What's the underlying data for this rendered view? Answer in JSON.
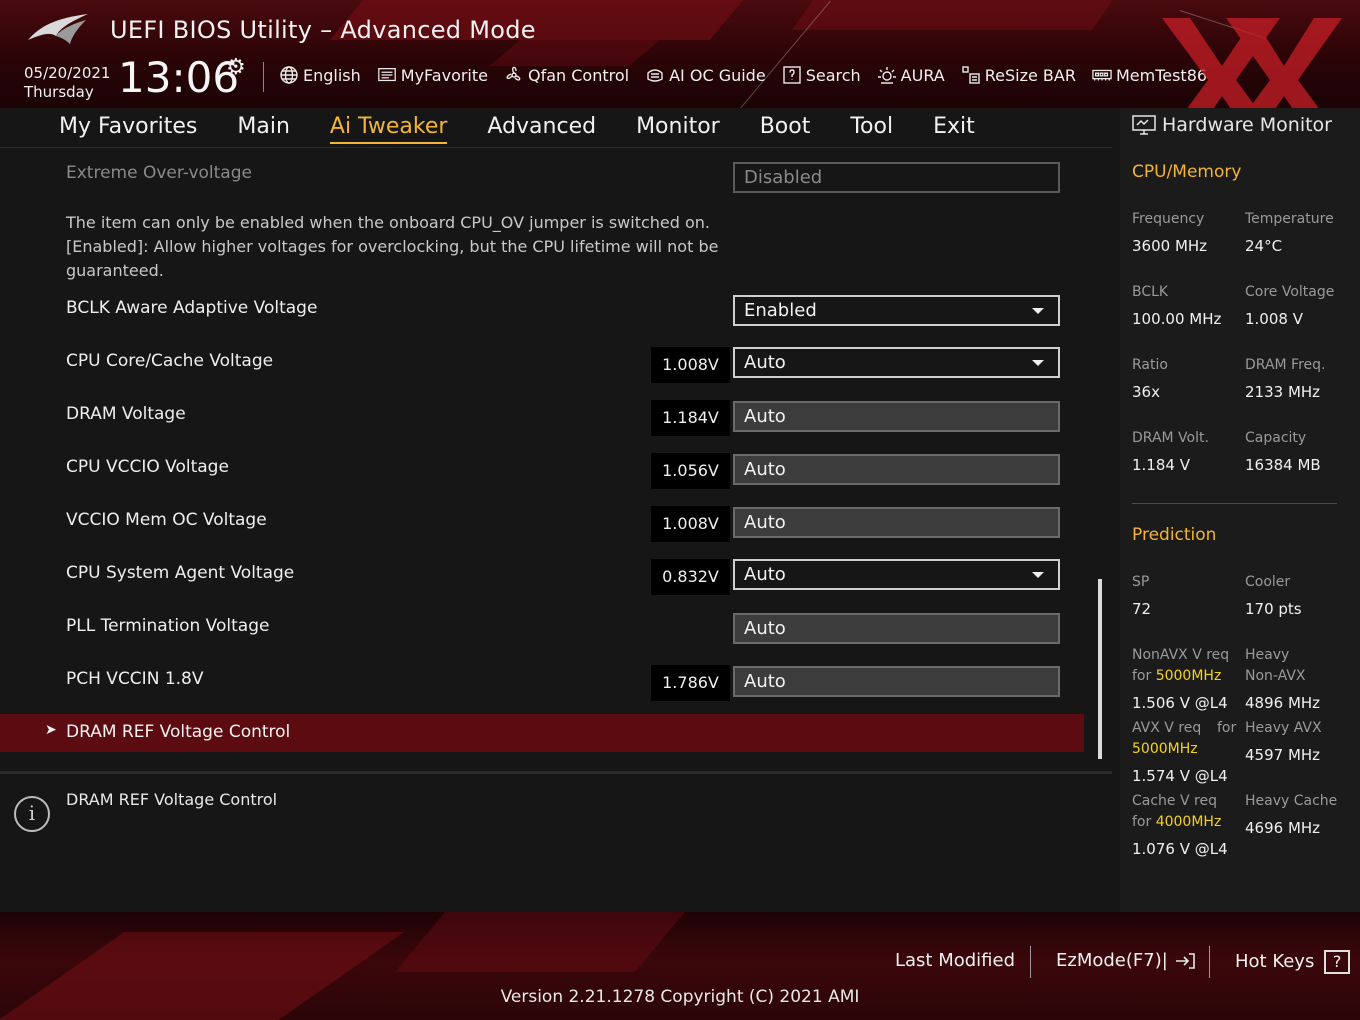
{
  "header": {
    "app_title": "UEFI BIOS Utility – Advanced Mode",
    "date": "05/20/2021",
    "day": "Thursday",
    "time": "13:06",
    "toolbar": [
      {
        "label": "English",
        "icon": "globe-icon"
      },
      {
        "label": "MyFavorite",
        "icon": "favorite-icon"
      },
      {
        "label": "Qfan Control",
        "icon": "fan-icon"
      },
      {
        "label": "AI OC Guide",
        "icon": "oc-guide-icon"
      },
      {
        "label": "Search",
        "icon": "search-icon"
      },
      {
        "label": "AURA",
        "icon": "aura-icon"
      },
      {
        "label": "ReSize BAR",
        "icon": "resize-bar-icon"
      },
      {
        "label": "MemTest86",
        "icon": "memtest-icon"
      }
    ]
  },
  "menu": {
    "items": [
      "My Favorites",
      "Main",
      "Ai Tweaker",
      "Advanced",
      "Monitor",
      "Boot",
      "Tool",
      "Exit"
    ],
    "active": "Ai Tweaker"
  },
  "settings": {
    "extreme_over_voltage": {
      "label": "Extreme Over-voltage",
      "value": "Disabled"
    },
    "description": "The item can only be enabled when the onboard CPU_OV jumper is switched on. [Enabled]: Allow higher voltages for overclocking, but the CPU lifetime will not be guaranteed.",
    "rows": [
      {
        "label": "BCLK Aware Adaptive Voltage",
        "reading": "",
        "value": "Enabled",
        "dropdown": true
      },
      {
        "label": "CPU Core/Cache Voltage",
        "reading": "1.008V",
        "value": "Auto",
        "dropdown": true
      },
      {
        "label": "DRAM Voltage",
        "reading": "1.184V",
        "value": "Auto",
        "dropdown": false
      },
      {
        "label": "CPU VCCIO Voltage",
        "reading": "1.056V",
        "value": "Auto",
        "dropdown": false
      },
      {
        "label": "VCCIO Mem OC Voltage",
        "reading": "1.008V",
        "value": "Auto",
        "dropdown": false
      },
      {
        "label": "CPU System Agent Voltage",
        "reading": "0.832V",
        "value": "Auto",
        "dropdown": true
      },
      {
        "label": "PLL Termination Voltage",
        "reading": "",
        "value": "Auto",
        "dropdown": false
      },
      {
        "label": "PCH VCCIN 1.8V",
        "reading": "1.786V",
        "value": "Auto",
        "dropdown": false
      }
    ],
    "submenu": {
      "label": "DRAM REF Voltage Control"
    }
  },
  "help": {
    "text": "DRAM REF Voltage Control"
  },
  "hardware_monitor": {
    "title": "Hardware Monitor",
    "cpu_memory": {
      "heading": "CPU/Memory",
      "frequency": {
        "label": "Frequency",
        "value": "3600 MHz"
      },
      "temperature": {
        "label": "Temperature",
        "value": "24°C"
      },
      "bclk": {
        "label": "BCLK",
        "value": "100.00 MHz"
      },
      "core_voltage": {
        "label": "Core Voltage",
        "value": "1.008 V"
      },
      "ratio": {
        "label": "Ratio",
        "value": "36x"
      },
      "dram_freq": {
        "label": "DRAM Freq.",
        "value": "2133 MHz"
      },
      "dram_volt": {
        "label": "DRAM Volt.",
        "value": "1.184 V"
      },
      "capacity": {
        "label": "Capacity",
        "value": "16384 MB"
      }
    },
    "prediction": {
      "heading": "Prediction",
      "sp": {
        "label": "SP",
        "value": "72"
      },
      "cooler": {
        "label": "Cooler",
        "value": "170 pts"
      },
      "nonavx_req": {
        "label": "NonAVX V req",
        "for": "for",
        "freq": "5000MHz",
        "value": "1.506 V @L4"
      },
      "heavy_nonavx": {
        "label1": "Heavy",
        "label2": "Non-AVX",
        "value": "4896 MHz"
      },
      "avx_req": {
        "label": "AVX V req",
        "for": "for",
        "freq": "5000MHz",
        "value": "1.574 V @L4"
      },
      "heavy_avx": {
        "label": "Heavy AVX",
        "value": "4597 MHz"
      },
      "cache_req": {
        "label": "Cache V req",
        "for": "for",
        "freq": "4000MHz",
        "value": "1.076 V @L4"
      },
      "heavy_cache": {
        "label": "Heavy Cache",
        "value": "4696 MHz"
      }
    }
  },
  "footer": {
    "last_modified": "Last Modified",
    "ezmode": "EzMode(F7)|",
    "hot_keys": "Hot Keys",
    "hot_keys_key": "?",
    "copyright": "Version 2.21.1278 Copyright (C) 2021 AMI"
  },
  "colors": {
    "accent": "#f3b437",
    "highlight": "#f5d31c",
    "selected_row": "#5c0c10",
    "brand_red": "#c81e26"
  }
}
